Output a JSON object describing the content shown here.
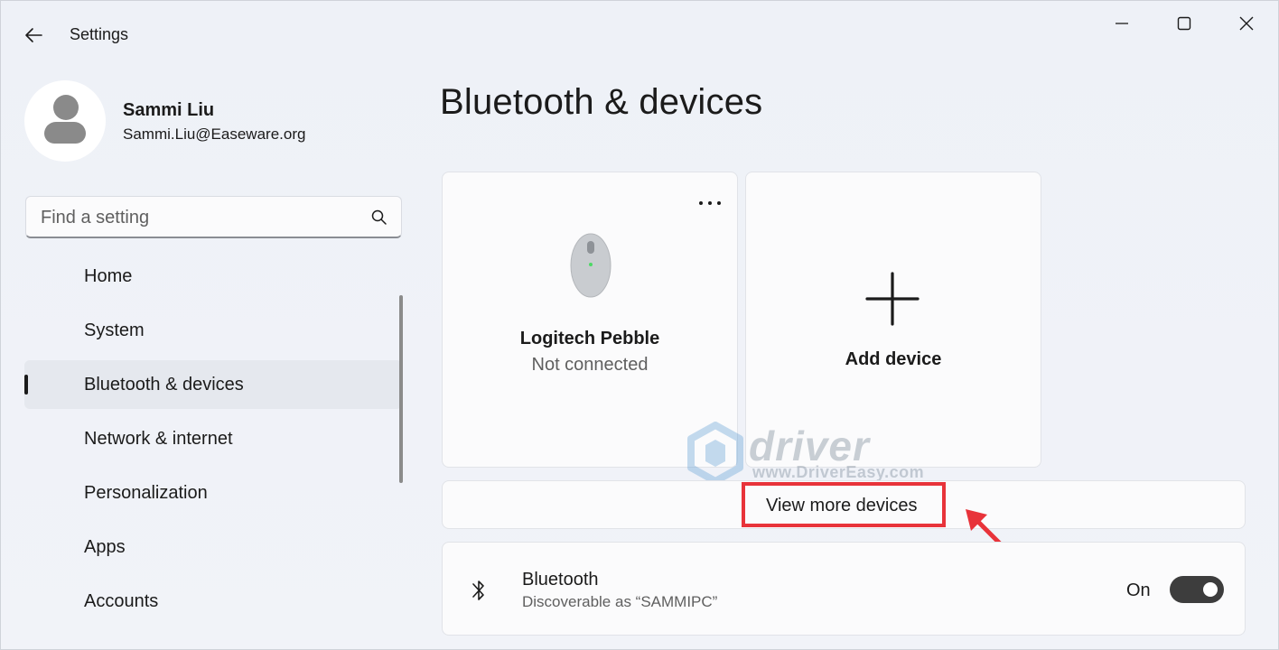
{
  "window": {
    "title": "Settings"
  },
  "profile": {
    "name": "Sammi Liu",
    "email": "Sammi.Liu@Easeware.org"
  },
  "search": {
    "placeholder": "Find a setting"
  },
  "sidebar": {
    "items": [
      {
        "label": "Home",
        "active": false
      },
      {
        "label": "System",
        "active": false
      },
      {
        "label": "Bluetooth & devices",
        "active": true
      },
      {
        "label": "Network & internet",
        "active": false
      },
      {
        "label": "Personalization",
        "active": false
      },
      {
        "label": "Apps",
        "active": false
      },
      {
        "label": "Accounts",
        "active": false
      }
    ]
  },
  "main": {
    "title": "Bluetooth & devices",
    "devices": [
      {
        "name": "Logitech Pebble",
        "status": "Not connected",
        "icon": "mouse-icon"
      }
    ],
    "add_device_label": "Add device",
    "view_more_label": "View more devices",
    "bluetooth": {
      "title": "Bluetooth",
      "subtitle": "Discoverable as “SAMMIPC”",
      "state_label": "On",
      "enabled": true
    }
  },
  "watermark": {
    "brand": "driver easy",
    "url": "www.DriverEasy.com"
  },
  "colors": {
    "annotation": "#e8333a",
    "toggle_on": "#3d3d3d"
  }
}
